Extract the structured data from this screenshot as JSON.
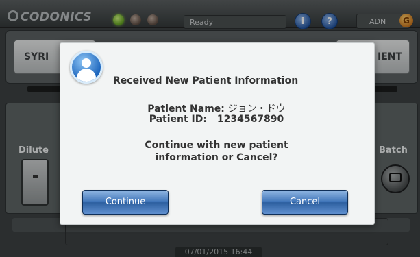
{
  "header": {
    "logo_text": "CODONICS",
    "status": "Ready",
    "info_button": "i",
    "help_button": "?",
    "user": "ADN",
    "user_badge": "G"
  },
  "tabs": [
    "SYRI",
    "IENT"
  ],
  "side": {
    "dilute_label": "Dilute",
    "batch_label": "Batch"
  },
  "footer": {
    "datetime": "07/01/2015 16:44"
  },
  "dialog": {
    "title": "Received New Patient Information",
    "patient_name_label": "Patient Name:",
    "patient_name": "ジョン・ドウ",
    "patient_id_label": "Patient ID:",
    "patient_id": "1234567890",
    "prompt_line1": "Continue with new patient",
    "prompt_line2": "information or Cancel?",
    "continue_label": "Continue",
    "cancel_label": "Cancel"
  }
}
